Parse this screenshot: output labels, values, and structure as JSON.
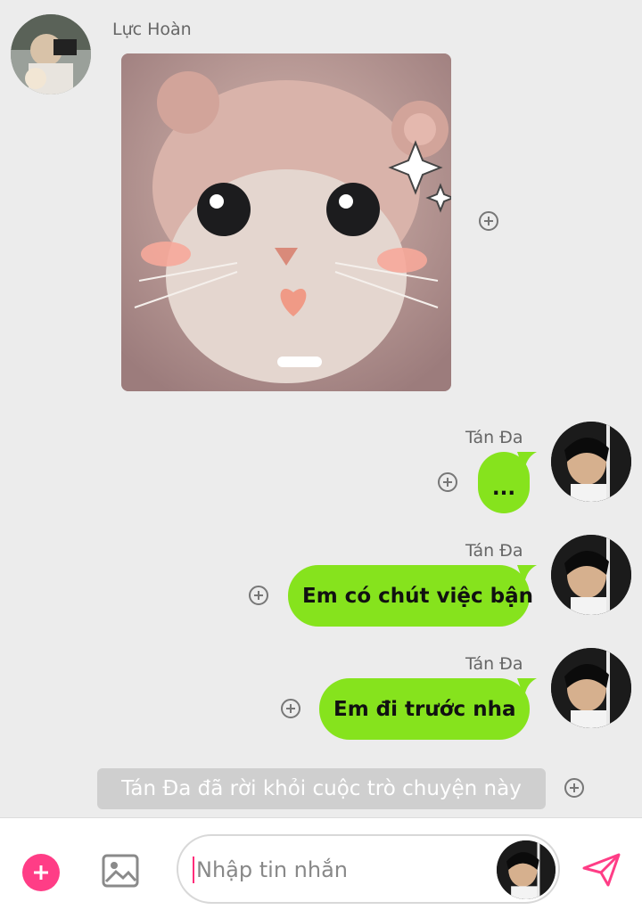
{
  "messages": {
    "incoming": {
      "sender": "Lực Hoàn",
      "image_description": "cat-in-hat-sticker"
    },
    "outgoing": [
      {
        "sender": "Tán Đa",
        "text": "..."
      },
      {
        "sender": "Tán Đa",
        "text": "Em có chút việc bận"
      },
      {
        "sender": "Tán Đa",
        "text": "Em đi trước nha"
      }
    ],
    "system": "Tán Đa đã rời khỏi cuộc trò chuyện này"
  },
  "composer": {
    "placeholder": "Nhập tin nhắn"
  },
  "colors": {
    "bubble": "#86e31d",
    "accent": "#ff3d86",
    "background": "#ececec"
  },
  "icons": {
    "add": "plus-circle-icon",
    "image": "image-icon",
    "send": "send-icon",
    "react": "plus-circle-outline-icon"
  }
}
